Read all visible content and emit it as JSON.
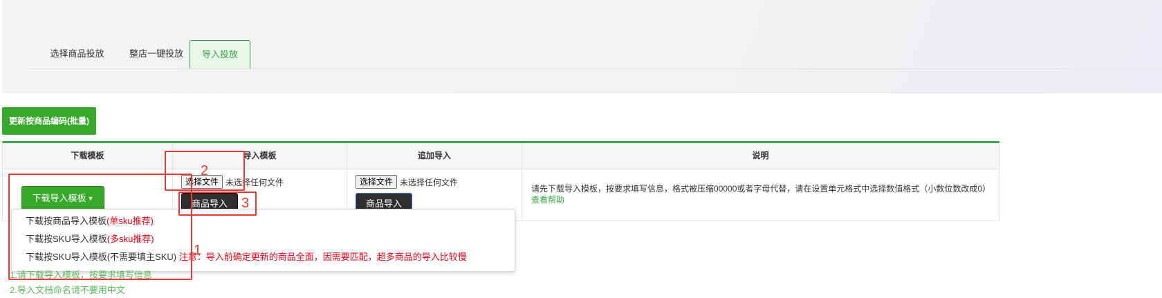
{
  "tabs": [
    {
      "label": "选择商品投放"
    },
    {
      "label": "整店一键投放"
    },
    {
      "label": "导入投放"
    }
  ],
  "update_button": {
    "label": "更新按商品编码(批量)"
  },
  "table": {
    "headers": [
      "下载模板",
      "导入模板",
      "追加导入",
      "说明"
    ],
    "download_button": {
      "label": "下载导入模板"
    },
    "import_template": {
      "file_button": "选择文件",
      "file_status": "未选择任何文件",
      "import_button": "商品导入"
    },
    "append_import": {
      "file_button": "选择文件",
      "file_status": "未选择任何文件",
      "import_button": "商品导入"
    },
    "description": {
      "text": "请先下载导入模板，按要求填写信息，格式被压缩00000或者字母代替，请在设置单元格式中选择数值格式（小数位数改成0）",
      "help_link": "查看帮助"
    }
  },
  "dropdown": {
    "items": [
      {
        "label": "下载按商品导入模板",
        "tag": "(单sku推荐)"
      },
      {
        "label": "下载按SKU导入模板",
        "tag": "(多sku推荐)"
      },
      {
        "label": "下载按SKU导入模板(不需要填主SKU)",
        "tag": "注意：导入前确定更新的商品全面，因需要匹配，超多商品的导入比较慢"
      }
    ]
  },
  "notes": [
    "1.请下载导入模板，按要求填写信息",
    "2.导入文档命名请不要用中文"
  ],
  "annotations": [
    "1",
    "2",
    "3"
  ],
  "colors": {
    "accent_green": "#36a82a",
    "tab_active_text": "#3aa744",
    "annotation_red": "#e53935",
    "warning_red": "#e60012"
  }
}
